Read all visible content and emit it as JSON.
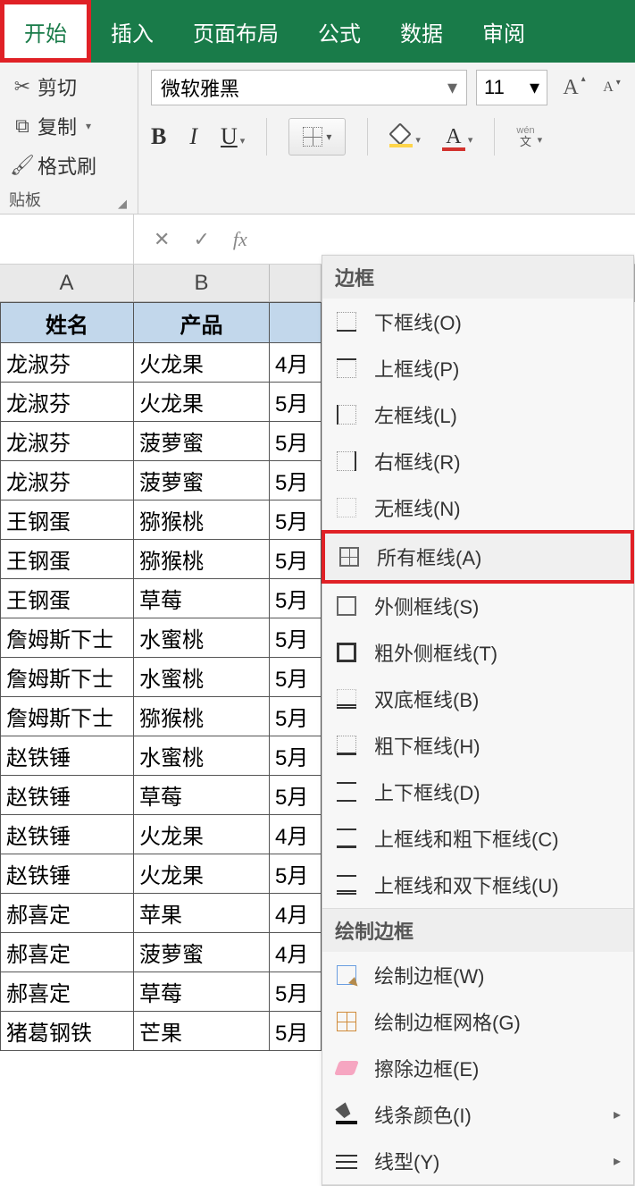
{
  "tabs": {
    "home": "开始",
    "insert": "插入",
    "layout": "页面布局",
    "formula": "公式",
    "data": "数据",
    "review": "审阅"
  },
  "clipboard": {
    "cut": "剪切",
    "copy": "复制",
    "painter": "格式刷",
    "group_label": "贴板"
  },
  "font": {
    "name": "微软雅黑",
    "size": "11",
    "bold": "B",
    "italic": "I",
    "underline": "U",
    "font_color_letter": "A",
    "increase_A": "A",
    "decrease_a": "A",
    "pinyin_top": "wén",
    "pinyin_bottom": "文"
  },
  "formula_bar": {
    "cancel": "✕",
    "confirm": "✓",
    "fx": "fx"
  },
  "columns": {
    "A": "A",
    "B": "B"
  },
  "headers": {
    "name": "姓名",
    "product": "产品"
  },
  "rows": [
    {
      "a": "龙淑芬",
      "b": "火龙果",
      "c": "4月"
    },
    {
      "a": "龙淑芬",
      "b": "火龙果",
      "c": "5月"
    },
    {
      "a": "龙淑芬",
      "b": "菠萝蜜",
      "c": "5月"
    },
    {
      "a": "龙淑芬",
      "b": "菠萝蜜",
      "c": "5月"
    },
    {
      "a": "王钢蛋",
      "b": "猕猴桃",
      "c": "5月"
    },
    {
      "a": "王钢蛋",
      "b": "猕猴桃",
      "c": "5月"
    },
    {
      "a": "王钢蛋",
      "b": "草莓",
      "c": "5月"
    },
    {
      "a": "詹姆斯下士",
      "b": "水蜜桃",
      "c": "5月"
    },
    {
      "a": "詹姆斯下士",
      "b": "水蜜桃",
      "c": "5月"
    },
    {
      "a": "詹姆斯下士",
      "b": "猕猴桃",
      "c": "5月"
    },
    {
      "a": "赵铁锤",
      "b": "水蜜桃",
      "c": "5月"
    },
    {
      "a": "赵铁锤",
      "b": "草莓",
      "c": "5月"
    },
    {
      "a": "赵铁锤",
      "b": "火龙果",
      "c": "4月"
    },
    {
      "a": "赵铁锤",
      "b": "火龙果",
      "c": "5月"
    },
    {
      "a": "郝喜定",
      "b": "苹果",
      "c": "4月"
    },
    {
      "a": "郝喜定",
      "b": "菠萝蜜",
      "c": "4月"
    },
    {
      "a": "郝喜定",
      "b": "草莓",
      "c": "5月"
    },
    {
      "a": "猪葛钢铁",
      "b": "芒果",
      "c": "5月"
    }
  ],
  "menu": {
    "section_border": "边框",
    "bottom": "下框线(O)",
    "top": "上框线(P)",
    "left": "左框线(L)",
    "right": "右框线(R)",
    "none": "无框线(N)",
    "all": "所有框线(A)",
    "outside": "外侧框线(S)",
    "thick_outside": "粗外侧框线(T)",
    "double_bottom": "双底框线(B)",
    "thick_bottom": "粗下框线(H)",
    "top_bottom": "上下框线(D)",
    "top_thick_bottom": "上框线和粗下框线(C)",
    "top_double_bottom": "上框线和双下框线(U)",
    "section_draw": "绘制边框",
    "draw_border": "绘制边框(W)",
    "draw_grid": "绘制边框网格(G)",
    "erase": "擦除边框(E)",
    "line_color": "线条颜色(I)",
    "line_style": "线型(Y)"
  }
}
